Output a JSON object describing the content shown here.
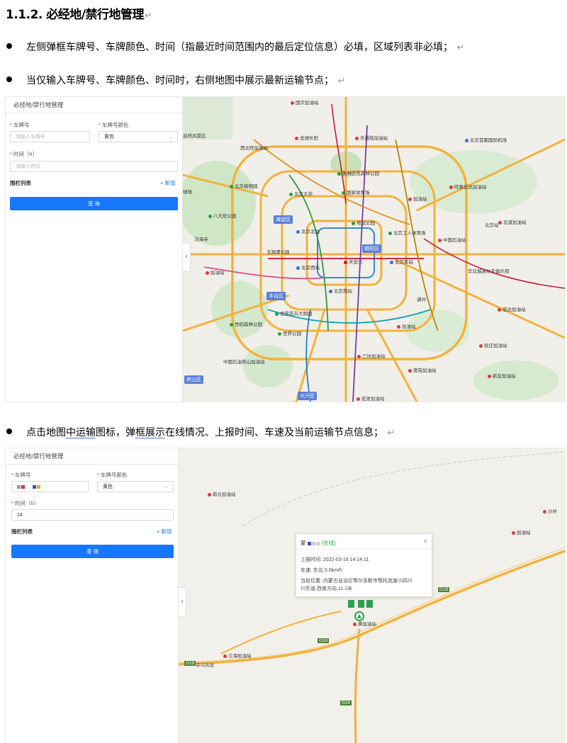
{
  "doc": {
    "heading": "1.1.2. 必经地/禁行地管理",
    "bullet1": "左侧弹框车牌号、车牌颜色、时间（指最近时间范围内的最后定位信息）必填，区域列表非必填；",
    "bullet2": "当仅输入车牌号、车牌颜色、时间时，右侧地图中展示最新运输节点；",
    "bullet3_a": "点击地图",
    "bullet3_b": "中运输",
    "bullet3_c": "图标，弹",
    "bullet3_d": "框展示",
    "bullet3_e": "在线情况、上报时间、车速及当前运输节点信息；",
    "return_mark": "↵"
  },
  "screen1": {
    "panel_title": "必经地/禁行地管理",
    "plate_label": "车牌号",
    "plate_placeholder": "请输入车牌号",
    "color_label": "车牌号颜色",
    "color_value": "黄色",
    "time_label": "时间（h）",
    "time_placeholder": "请输入时间",
    "fence_label": "围栏列表",
    "add_label": "+ 新增",
    "query_label": "查 询",
    "districts": [
      "海淀区",
      "朝阳区",
      "丰台区",
      "房山区",
      "大兴区"
    ],
    "places": [
      "国华加油站",
      "自然风景区",
      "龙湖长田",
      "天通苑加油站",
      "北京首都国际机场",
      "西北旺加油站",
      "奥林匹克森林公园",
      "北京植物园",
      "北京大学",
      "国家体育场",
      "加油站",
      "旺泰宏达加油站",
      "八大处公园",
      "北京北站",
      "地坛公园",
      "北京工人体育场",
      "北道加油站",
      "中国石油站",
      "玉渊潭公园",
      "北京东站",
      "北京西站",
      "天安门",
      "华北城高尔夫俱乐部",
      "加油站",
      "北京南站",
      "北京站",
      "宏达加油站",
      "世界花卉大观园",
      "通州",
      "世纪森林公园",
      "世界公园",
      "加油站",
      "徐庄加油站",
      "中国石油燕山加油站",
      "南苑加油站",
      "新友加油站",
      "宏发加油站",
      "球场",
      "法海寺",
      "三坟加油站"
    ]
  },
  "screen2": {
    "panel_title": "必经地/禁行地管理",
    "plate_label": "车牌号",
    "color_label": "车牌号颜色",
    "color_value": "黄色",
    "time_label": "时间（h）",
    "time_value": "24",
    "fence_label": "围栏列表",
    "add_label": "+ 新增",
    "query_label": "查 询",
    "places": [
      "新元加油站",
      "沙井",
      "加油站",
      "兰海加油站",
      "黄加油站"
    ],
    "roads": [
      "G18",
      "荣乌高速",
      "G18",
      "G18",
      "S24"
    ],
    "popup": {
      "plate_prefix": "蒙",
      "status": "(在线)",
      "close": "×",
      "report_label": "上报时间:",
      "report_value": "2022-03-16 14:14:11",
      "speed_label": "车速:",
      "speed_value": "东北 0.0km/h",
      "location_label": "当前位置:",
      "location_value_1": "内蒙古自治区鄂尔多斯市鄂托克旗小四川",
      "location_value_2": "川东道,西南方向,11.1米"
    }
  }
}
